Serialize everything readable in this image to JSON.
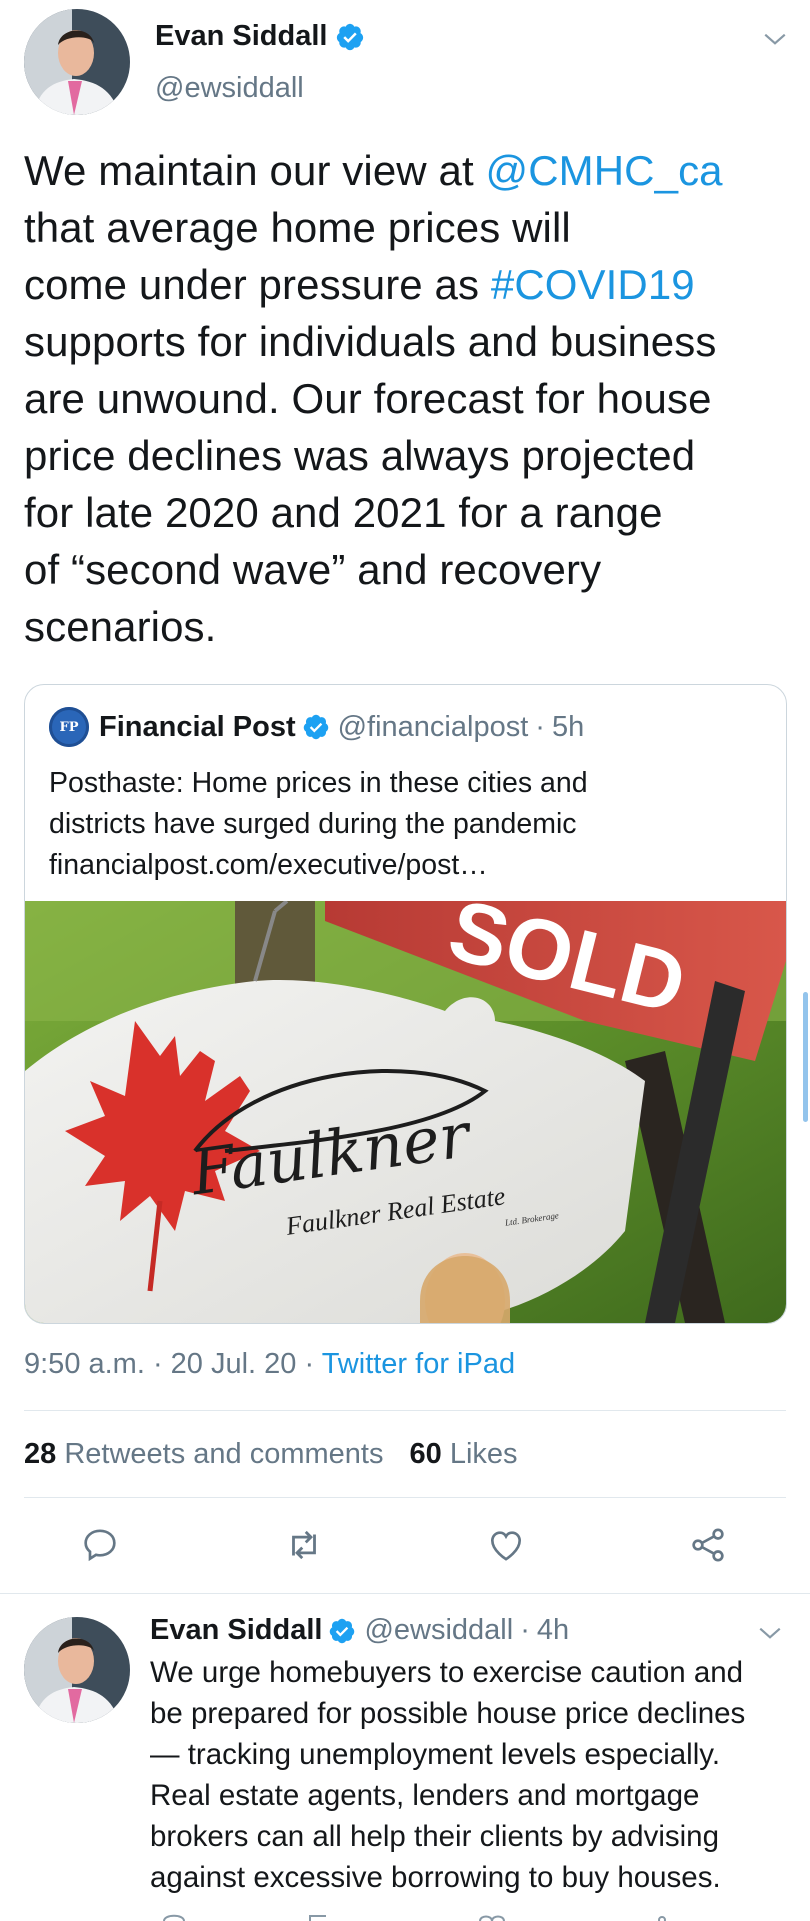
{
  "main_tweet": {
    "author": {
      "name": "Evan Siddall",
      "handle": "@ewsiddall",
      "verified": true
    },
    "text_lines": [
      [
        {
          "t": "We maintain our view at "
        },
        {
          "t": "@CMHC_ca",
          "link": true
        }
      ],
      [
        {
          "t": "that average home prices will"
        }
      ],
      [
        {
          "t": "come under pressure as "
        },
        {
          "t": "#COVID19",
          "link": true
        }
      ],
      [
        {
          "t": "supports for individuals and business"
        }
      ],
      [
        {
          "t": "are unwound. Our forecast for house"
        }
      ],
      [
        {
          "t": "price declines was always projected"
        }
      ],
      [
        {
          "t": "for late 2020 and 2021 for a range"
        }
      ],
      [
        {
          "t": "of “second wave” and recovery"
        }
      ],
      [
        {
          "t": "scenarios."
        }
      ]
    ],
    "quoted": {
      "logo_text": "FP",
      "name": "Financial Post",
      "handle": "@financialpost",
      "separator": "·",
      "time": "5h",
      "text_lines": [
        "Posthaste: Home prices in these cities and",
        "districts have surged during the pandemic",
        "financialpost.com/executive/post…"
      ],
      "image": {
        "sign_word": "SOLD",
        "brand_script": "Faulkner",
        "brand_name": "Faulkner Real Estate",
        "brand_sub": "Ltd. Brokerage"
      }
    },
    "timestamp": "9:50 a.m. · 20 Jul. 20 · ",
    "source": "Twitter for iPad",
    "stats": {
      "retweets_count": "28",
      "retweets_label": "Retweets and comments",
      "likes_count": "60",
      "likes_label": "Likes"
    },
    "action_icons": [
      "reply-icon",
      "retweet-icon",
      "like-icon",
      "share-icon"
    ]
  },
  "reply_tweet": {
    "author": {
      "name": "Evan Siddall",
      "handle": "@ewsiddall",
      "verified": true
    },
    "separator": "·",
    "time": "4h",
    "text_lines": [
      "We urge homebuyers to exercise caution and",
      "be prepared for possible house price declines",
      "— tracking unemployment levels especially.",
      "Real estate agents, lenders and mortgage",
      "brokers can all help their clients by advising",
      "against excessive borrowing to buy houses."
    ]
  },
  "colors": {
    "link": "#1b95e0",
    "muted": "#657786",
    "verified": "#1da1f2",
    "divider": "#e1e8ed",
    "text": "#14171a"
  }
}
